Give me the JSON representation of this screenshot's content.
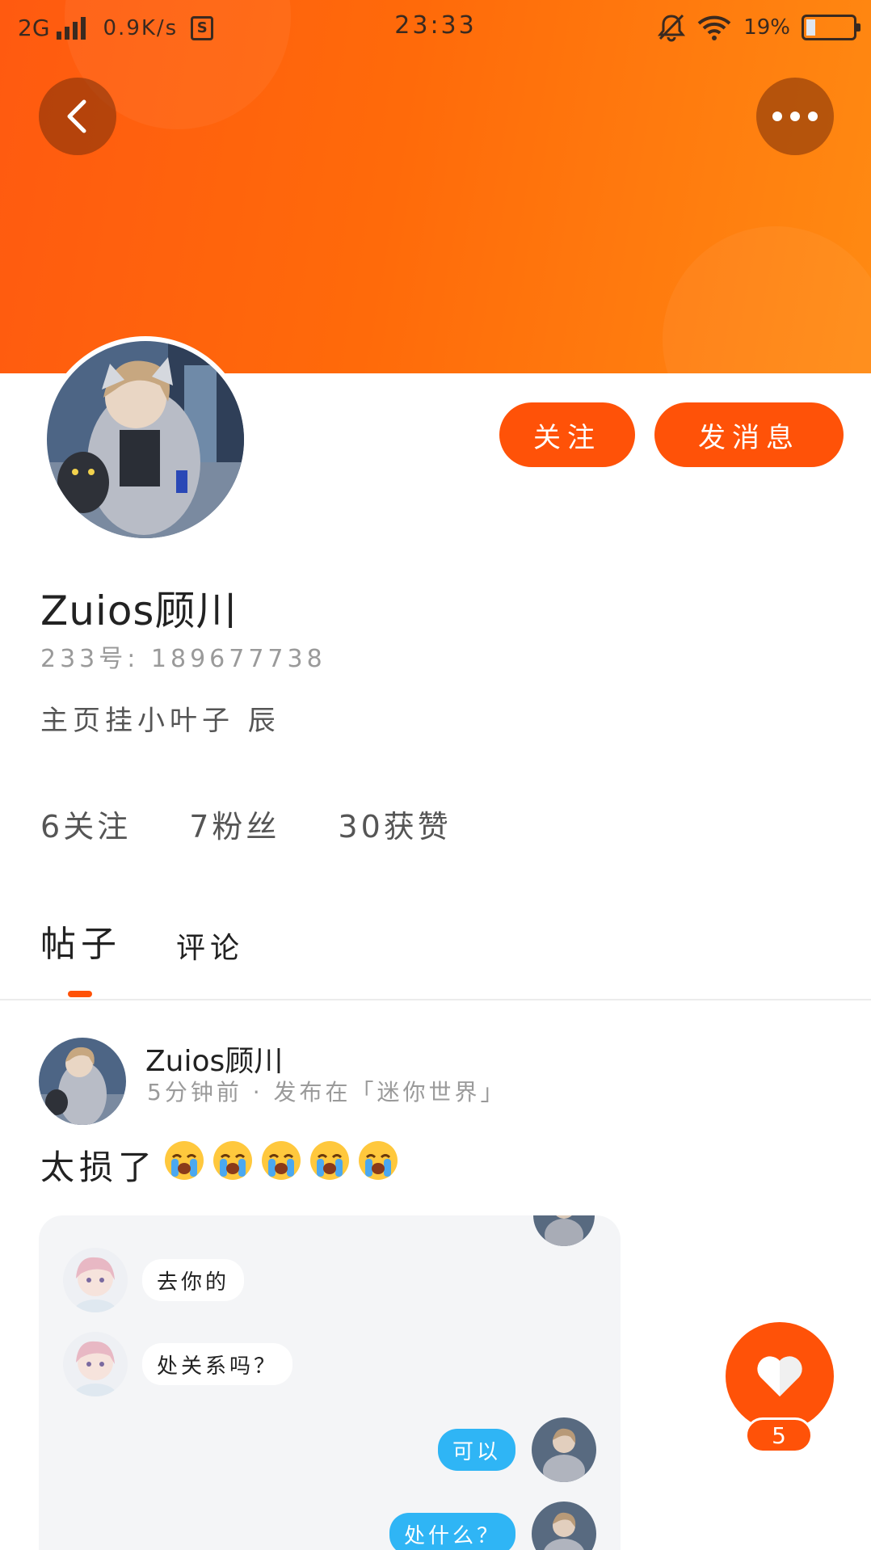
{
  "status_bar": {
    "network": "2G",
    "speed": "0.9K/s",
    "time": "23:33",
    "battery": "19%",
    "battery_level": 0.19
  },
  "header": {
    "back_icon": "chevron-left-icon",
    "more_icon": "more-dots-icon",
    "accent_color": "#ff5a10"
  },
  "profile": {
    "name": "Zuios顾川",
    "id_line": "233号: 189677738",
    "bio": "主页挂小叶子 辰",
    "follow_label": "关注",
    "message_label": "发消息",
    "stats": [
      {
        "count": "6",
        "label": "关注"
      },
      {
        "count": "7",
        "label": "粉丝"
      },
      {
        "count": "30",
        "label": "获赞"
      }
    ]
  },
  "tabs": [
    {
      "label": "帖子",
      "active": true
    },
    {
      "label": "评论",
      "active": false
    }
  ],
  "post": {
    "author": "Zuios顾川",
    "meta": "5分钟前 · 发布在「迷你世界」",
    "text": "太损了",
    "emoji": "loudly-crying-face-icon",
    "emoji_count": 5,
    "chat": [
      {
        "side": "left",
        "text": "去你的"
      },
      {
        "side": "left",
        "text": "处关系吗？"
      },
      {
        "side": "right",
        "text": "可以"
      },
      {
        "side": "right",
        "text": "处什么？"
      }
    ]
  },
  "like": {
    "icon": "heart-icon",
    "count": "5"
  }
}
